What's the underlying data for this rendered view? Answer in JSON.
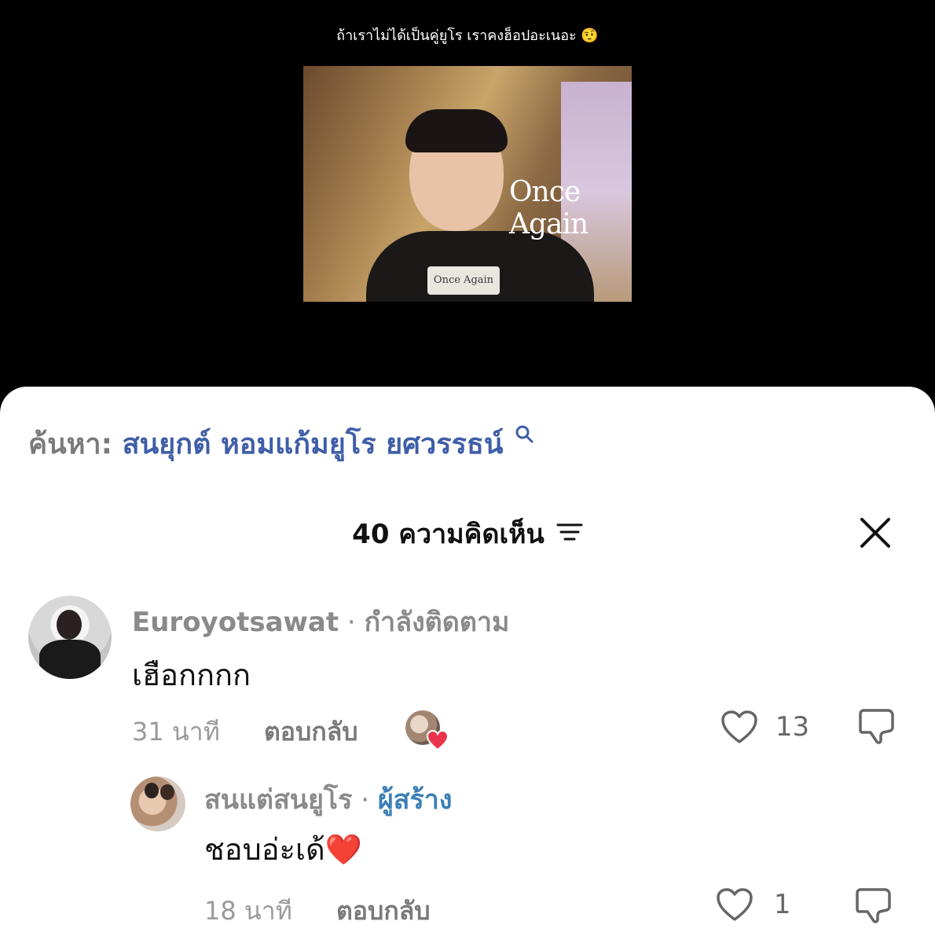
{
  "video": {
    "caption": "ถ้าเราไม่ได้เป็นคู่ยูโร เราคงฮ็อปอะเนอะ 🤨",
    "poster_title": "Once Again",
    "mic_label": "Once Again"
  },
  "search": {
    "prefix": "ค้นหา:",
    "query": "สนยุกต์ หอมแก้มยูโร ยศวรรธน์"
  },
  "comments_header": {
    "title": "40 ความคิดเห็น"
  },
  "comments": [
    {
      "username": "Euroyotsawat",
      "separator": " · ",
      "status": "กำลังติดตาม",
      "text": "เฮือกกกก",
      "time": "31 นาที",
      "reply_label": "ตอบกลับ",
      "likes": "13"
    },
    {
      "username": "สนแต่สนยูโร",
      "separator": " · ",
      "creator_label": "ผู้สร้าง",
      "text": "ชอบอ่ะเด้",
      "text_emoji": "❤️",
      "time": "18 นาที",
      "reply_label": "ตอบกลับ",
      "likes": "1"
    }
  ],
  "colors": {
    "search_term": "#3f5ea8",
    "creator": "#3c7fb6",
    "heart_red": "#e8344a"
  }
}
